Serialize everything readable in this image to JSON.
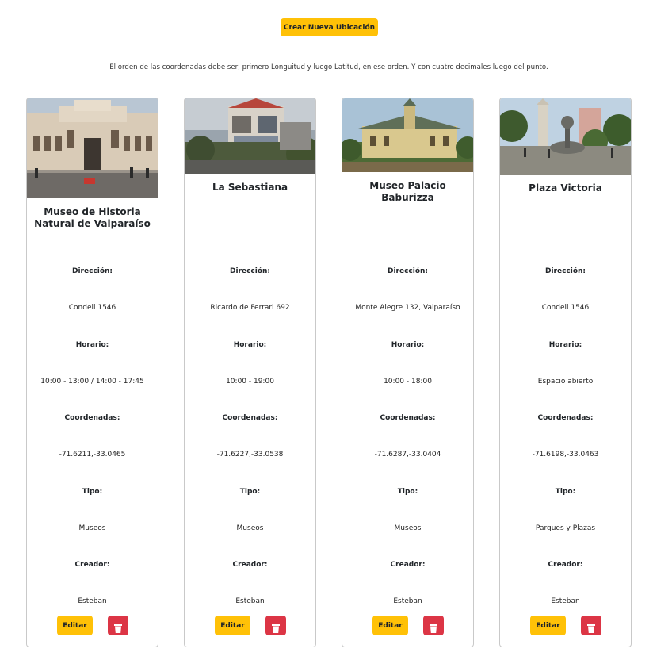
{
  "header": {
    "create_label": "Crear Nueva Ubicación",
    "notice": "El orden de las coordenadas debe ser, primero Longuitud y luego Latitud, en ese orden. Y con cuatro decimales luego del punto."
  },
  "labels": {
    "address": "Dirección:",
    "schedule": "Horario:",
    "coords": "Coordenadas:",
    "type": "Tipo:",
    "creator": "Creador:"
  },
  "buttons": {
    "edit": "Editar",
    "delete_icon": "trash-icon"
  },
  "colors": {
    "warning": "#ffc107",
    "danger": "#dc3545"
  },
  "cards": [
    {
      "title": "Museo de Historia Natural de Valparaíso",
      "address": "Condell 1546",
      "schedule": "10:00 - 13:00 / 14:00 - 17:45",
      "coords": "-71.6211,-33.0465",
      "type": "Museos",
      "creator": "Esteban",
      "image": "museum-building-photo"
    },
    {
      "title": "La Sebastiana",
      "address": "Ricardo de Ferrari 692",
      "schedule": "10:00 - 19:00",
      "coords": "-71.6227,-33.0538",
      "type": "Museos",
      "creator": "Esteban",
      "image": "house-photo"
    },
    {
      "title": "Museo Palacio Baburizza",
      "address": "Monte Alegre 132, Valparaíso",
      "schedule": "10:00 - 18:00",
      "coords": "-71.6287,-33.0404",
      "type": "Museos",
      "creator": "Esteban",
      "image": "palace-photo"
    },
    {
      "title": "Plaza Victoria",
      "address": "Condell 1546",
      "schedule": "Espacio abierto",
      "coords": "-71.6198,-33.0463",
      "type": "Parques y Plazas",
      "creator": "Esteban",
      "image": "plaza-photo"
    }
  ]
}
